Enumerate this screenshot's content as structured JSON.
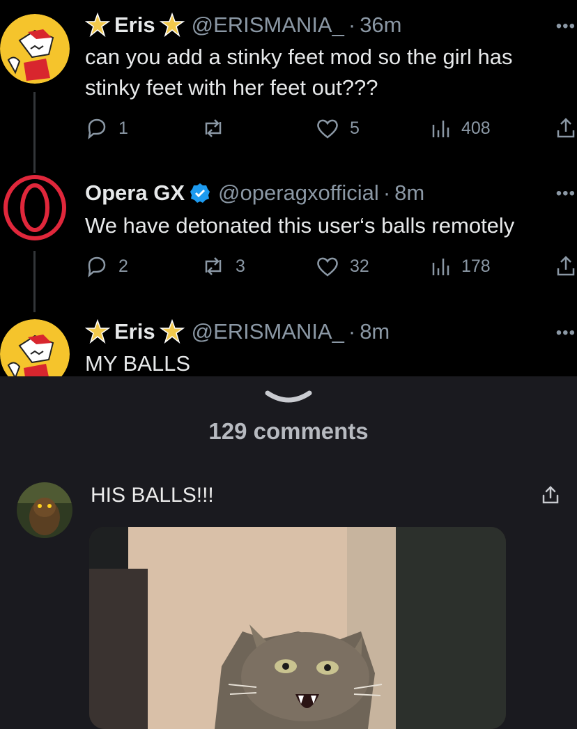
{
  "tweets": [
    {
      "name": "Eris",
      "handle": "@ERISMANIA_",
      "time": "36m",
      "text": "can you add a stinky feet mod so the girl has stinky feet with her feet out???",
      "replies": "1",
      "retweets": "",
      "likes": "5",
      "views": "408"
    },
    {
      "name": "Opera GX",
      "handle": "@operagxofficial",
      "time": "8m",
      "text": "We have detonated this user‘s balls remotely",
      "replies": "2",
      "retweets": "3",
      "likes": "32",
      "views": "178",
      "verified_color": "#1d9bf0"
    },
    {
      "name": "Eris",
      "handle": "@ERISMANIA_",
      "time": "8m",
      "text": "MY BALLS"
    }
  ],
  "icons": [
    "star-badge-icon",
    "verified-badge-icon",
    "reply-icon",
    "retweet-icon",
    "like-icon",
    "views-icon",
    "share-icon",
    "more-icon",
    "chevron-down-icon"
  ],
  "comments_section": {
    "title": "129 comments",
    "comment": {
      "text": "HIS BALLS!!!"
    }
  },
  "colors": {
    "tweet_background": "#000000",
    "sheet_background": "#1a1a1f",
    "muted_text": "#8b98a5",
    "opera_red": "#e0273b",
    "star_gold": "#f2c94c"
  }
}
